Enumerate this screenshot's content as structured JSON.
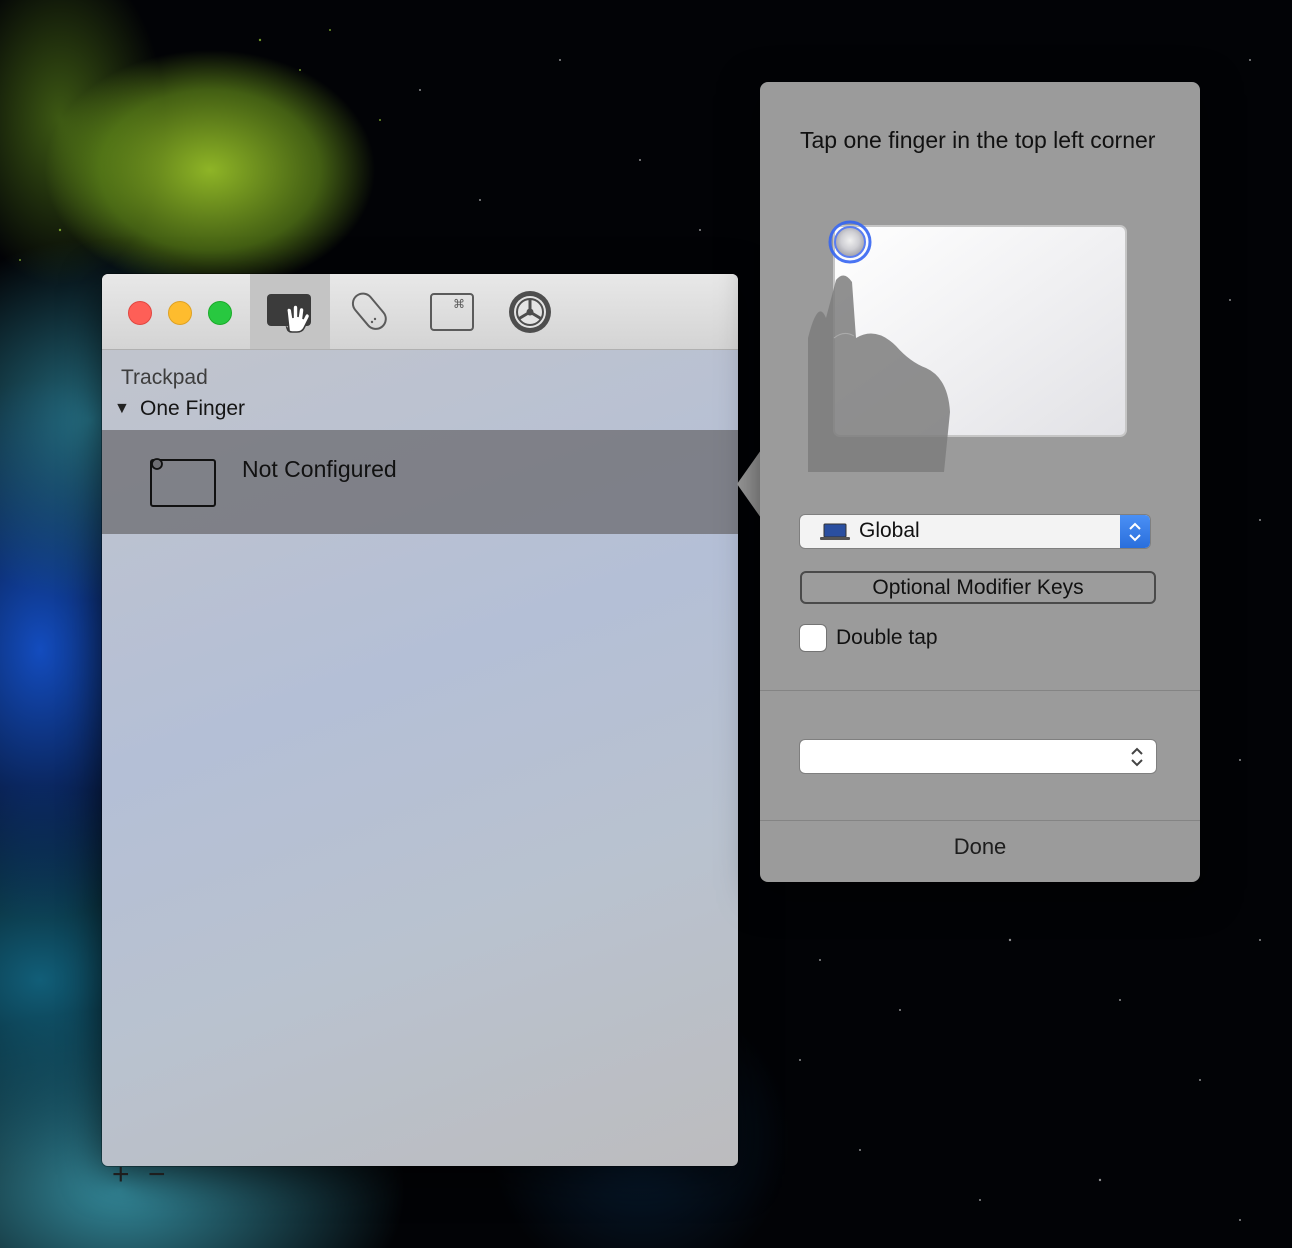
{
  "window": {
    "traffic_lights": [
      "close-button",
      "minimize-button",
      "zoom-button"
    ],
    "toolbar": [
      {
        "icon": "trackpad-hand-icon",
        "selected": true
      },
      {
        "icon": "magic-mouse-icon",
        "selected": false
      },
      {
        "icon": "command-key-icon",
        "selected": false
      },
      {
        "icon": "settings-gear-icon",
        "selected": false
      }
    ],
    "section_label": "Trackpad",
    "group_label": "One Finger",
    "group_disclosure": "▼",
    "item_label": "Not Configured",
    "add_label": "+",
    "remove_label": "−"
  },
  "popover": {
    "title": "Tap one finger in the top left corner",
    "app_select": {
      "value": "Global",
      "icon": "laptop-icon"
    },
    "modifier_button": "Optional Modifier Keys",
    "double_tap_label": "Double tap",
    "double_tap_checked": false,
    "action_select_value": "",
    "done_label": "Done"
  },
  "colors": {
    "accent": "#2a6fdc",
    "selection": "#6e6e73"
  }
}
